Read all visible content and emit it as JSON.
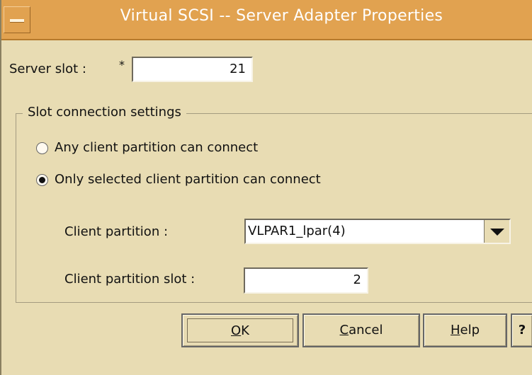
{
  "window": {
    "title": "Virtual SCSI -- Server Adapter Properties"
  },
  "server_slot": {
    "label": "Server slot :",
    "required_mark": "*",
    "value": "21"
  },
  "group": {
    "label": "Slot connection settings",
    "options": [
      {
        "label": "Any client partition can connect",
        "checked": false
      },
      {
        "label": "Only selected client partition can connect",
        "checked": true
      }
    ]
  },
  "client_partition": {
    "label": "Client partition :",
    "value": "VLPAR1_lpar(4)"
  },
  "client_partition_slot": {
    "label": "Client partition slot :",
    "value": "2"
  },
  "buttons": {
    "ok": "OK",
    "cancel": "Cancel",
    "help": "Help",
    "context_help": "?"
  },
  "icons": {
    "window_menu": "window-menu-icon",
    "dropdown": "dropdown-arrow-icon"
  }
}
